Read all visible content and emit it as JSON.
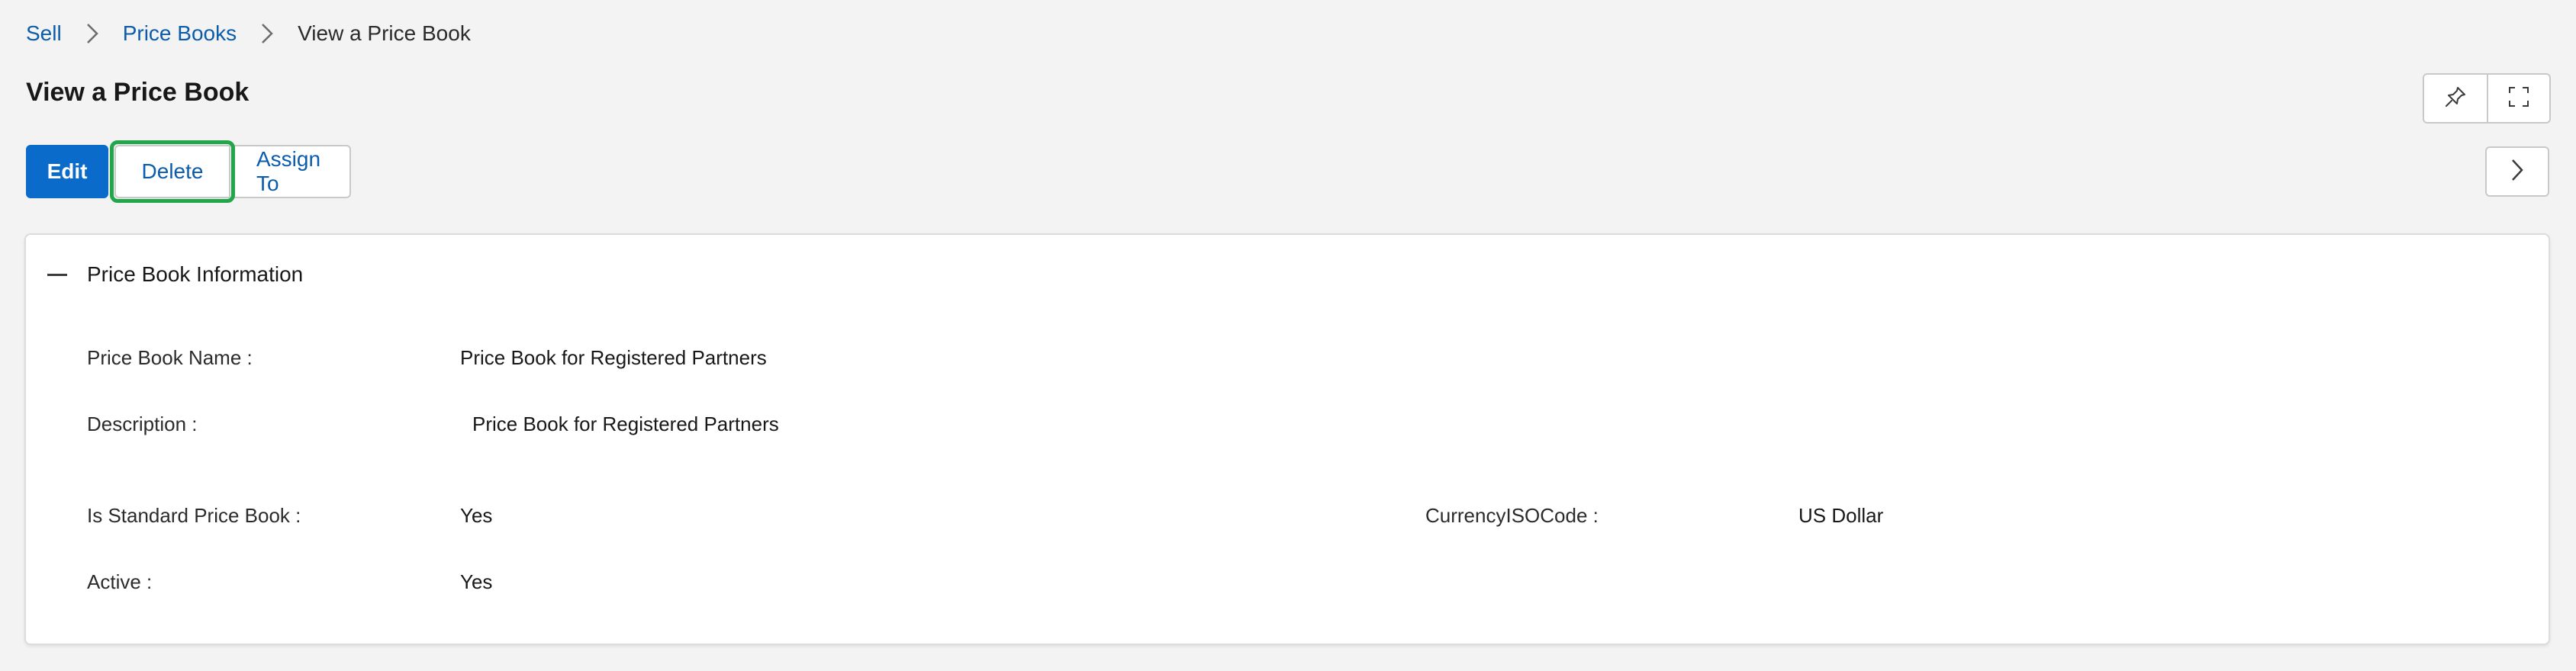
{
  "breadcrumb": {
    "items": [
      "Sell",
      "Price Books"
    ],
    "current": "View a Price Book"
  },
  "page": {
    "title": "View a Price Book"
  },
  "toolbar": {
    "edit_label": "Edit",
    "delete_label": "Delete",
    "assign_label": "Assign To"
  },
  "icons": {
    "pin": "pin-icon",
    "expand": "expand-icon",
    "next": "chevron-right-icon"
  },
  "section": {
    "title": "Price Book Information",
    "fields": {
      "name_label": "Price Book Name :",
      "name_value": "Price Book for Registered Partners",
      "description_label": "Description :",
      "description_value": "Price Book for Registered Partners",
      "standard_label": "Is Standard Price Book :",
      "standard_value": "Yes",
      "currency_label": "CurrencyISOCode :",
      "currency_value": "US Dollar",
      "active_label": "Active :",
      "active_value": "Yes"
    }
  },
  "colors": {
    "primary": "#0b6bcb",
    "link": "#0b5cab",
    "highlight": "#22a64a",
    "background": "#f3f3f3"
  }
}
